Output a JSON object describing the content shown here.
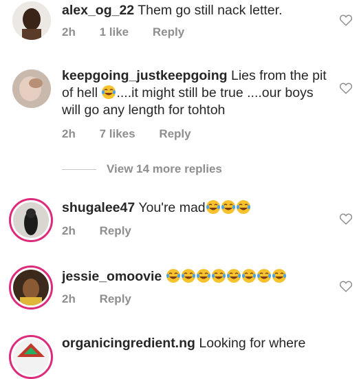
{
  "comments": [
    {
      "username": "alex_og_22",
      "text": "Them go still nack letter.",
      "time": "2h",
      "likes": "1 like",
      "reply": "Reply"
    },
    {
      "username": "keepgoing_justkeepgoing",
      "text_a": "Lies from the pit of hell",
      "text_b": "....it might still be true ....our boys will go any length for tohtoh",
      "time": "2h",
      "likes": "7 likes",
      "reply": "Reply"
    },
    {
      "username": "shugalee47",
      "text": "You're mad",
      "time": "2h",
      "reply": "Reply"
    },
    {
      "username": "jessie_omoovie",
      "time": "2h",
      "reply": "Reply"
    },
    {
      "username": "organicingredient.ng",
      "text": "Looking for where"
    }
  ],
  "view_more": "View 14 more replies",
  "colors": {
    "username": "#262626",
    "meta": "#8e8e8e",
    "story_ring": "#dd2a7b"
  },
  "icons": [
    "heart-outline-icon",
    "laughing-crying-emoji"
  ]
}
